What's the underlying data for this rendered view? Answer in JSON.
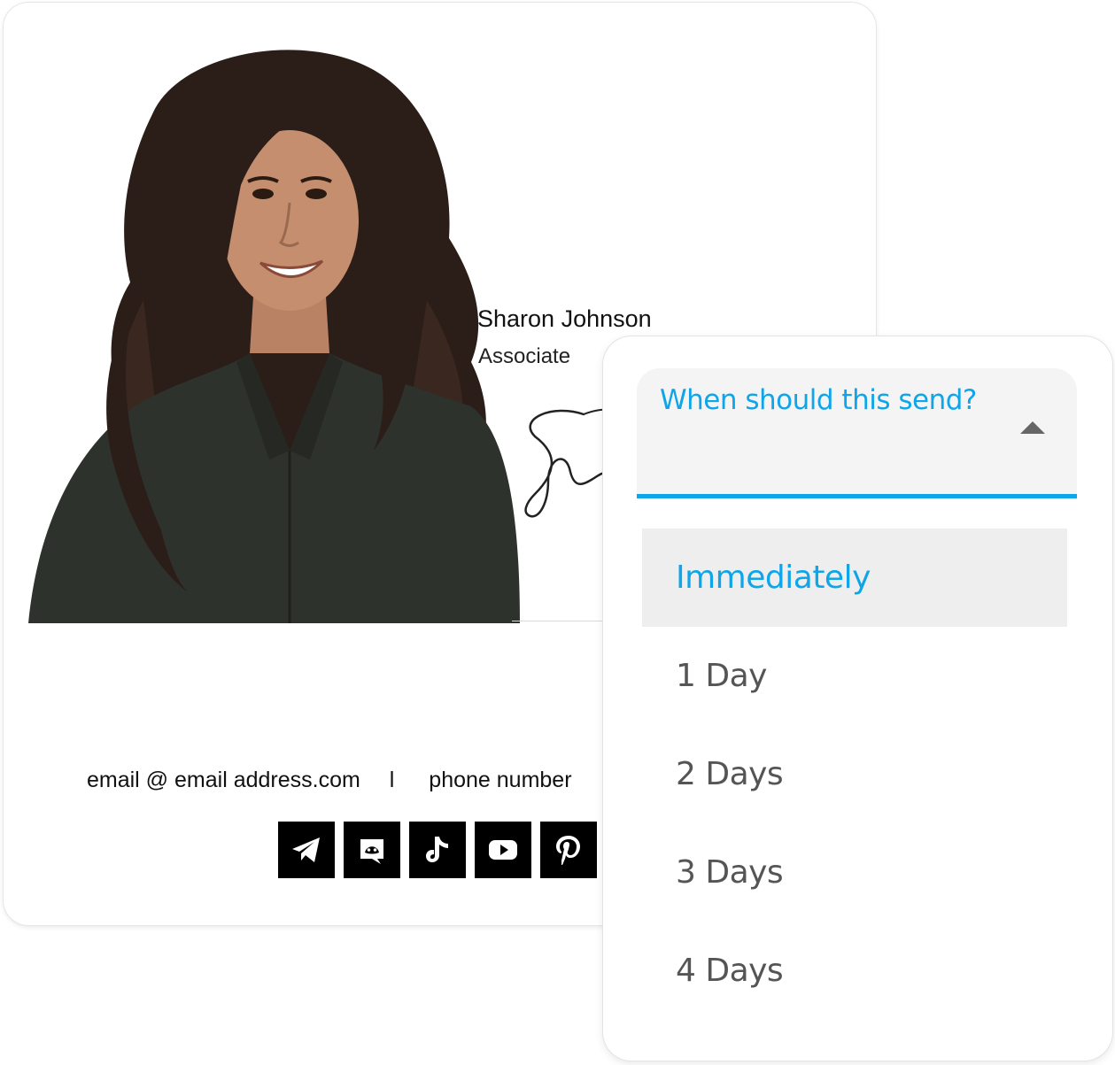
{
  "signature": {
    "name": "Sharon Johnson",
    "title": "Associate",
    "contact_email": "email @ email address.com",
    "contact_separator": "l",
    "contact_phone": "phone number",
    "socials": [
      {
        "icon": "telegram-icon"
      },
      {
        "icon": "discord-icon"
      },
      {
        "icon": "tiktok-icon"
      },
      {
        "icon": "youtube-icon"
      },
      {
        "icon": "pinterest-icon"
      }
    ]
  },
  "dropdown": {
    "label": "When should this send?",
    "options": [
      "Immediately",
      "1 Day",
      "2 Days",
      "3 Days",
      "4 Days"
    ],
    "selected": "Immediately",
    "accent": "#0ea5e9"
  }
}
